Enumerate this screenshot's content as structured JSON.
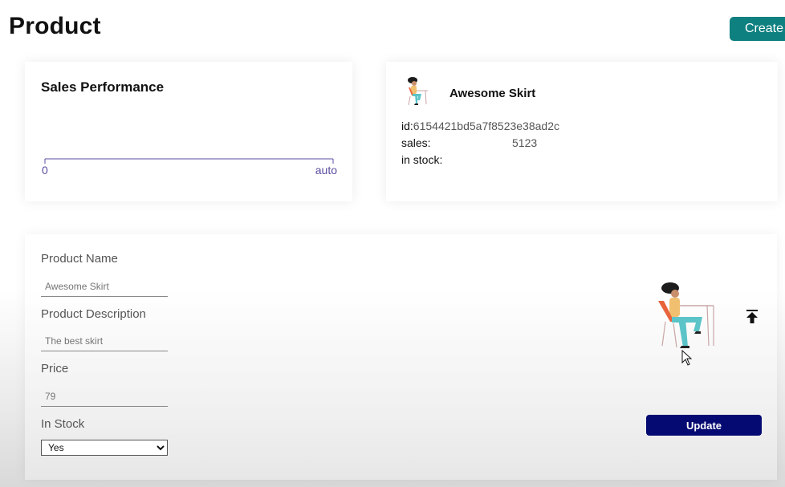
{
  "page": {
    "title": "Product",
    "create_label": "Create"
  },
  "chart": {
    "title": "Sales Performance",
    "chart_data": {
      "type": "line",
      "title": "Sales Performance",
      "x_ticks": [
        "0",
        "auto"
      ],
      "series": []
    }
  },
  "info": {
    "avatar_icon": "person-at-desk-icon",
    "name": "Awesome Skirt",
    "id_label": "id:",
    "id_value": "6154421bd5a7f8523e38ad2c",
    "sales_label": "sales:",
    "sales_value": "5123",
    "stock_label": "in stock:"
  },
  "form": {
    "name_label": "Product Name",
    "name_value": "Awesome Skirt",
    "description_label": "Product Description",
    "description_value": "The best skirt",
    "price_label": "Price",
    "price_value": "79",
    "stock_label": "In Stock",
    "stock_selected": "Yes",
    "update_label": "Update",
    "upload_icon": "upload-icon",
    "illustration_icon": "person-at-desk-icon"
  },
  "colors": {
    "create_button": "#0f8080",
    "update_button": "#050a72",
    "chart_axis": "#5a4fa0"
  }
}
